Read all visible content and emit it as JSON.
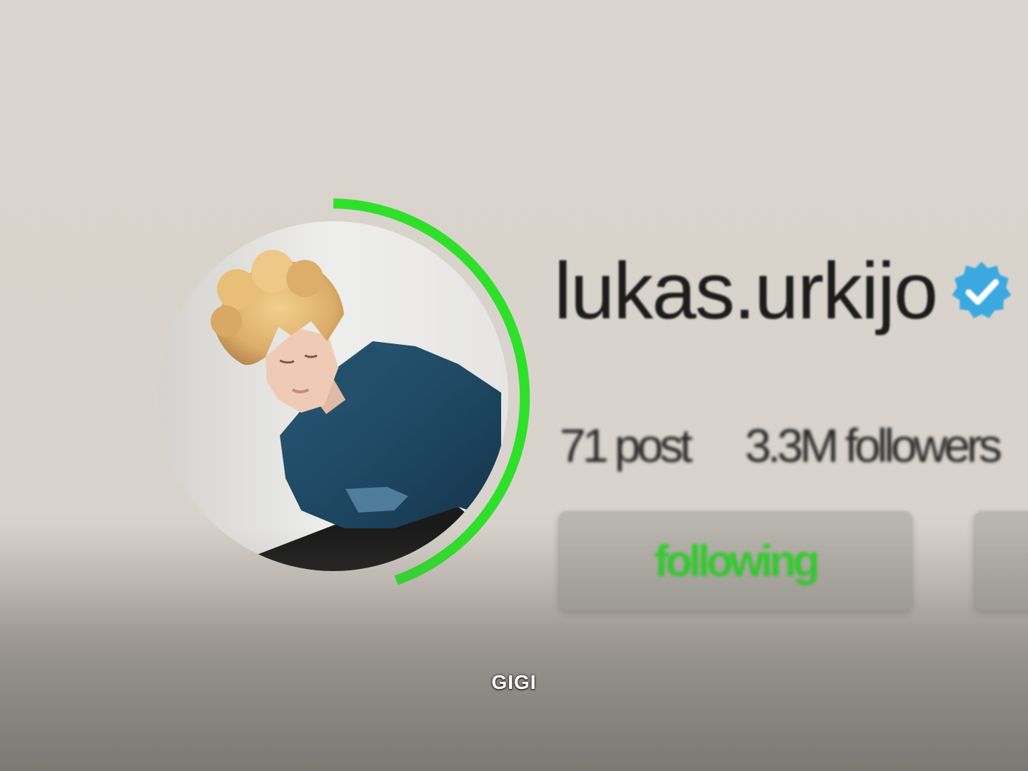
{
  "profile": {
    "username": "lukas.urkijo",
    "verified_icon": "verified-badge-icon",
    "stats": {
      "posts": "71 post",
      "followers": "3.3M followers"
    },
    "follow_button_label": "following",
    "story_progress": 0.42
  },
  "caption": {
    "text": "GIGI"
  },
  "colors": {
    "ring": "#2fe02a",
    "following_text": "#2ed22a",
    "verified": "#3ba9e0",
    "background": "#d9d4cd"
  }
}
